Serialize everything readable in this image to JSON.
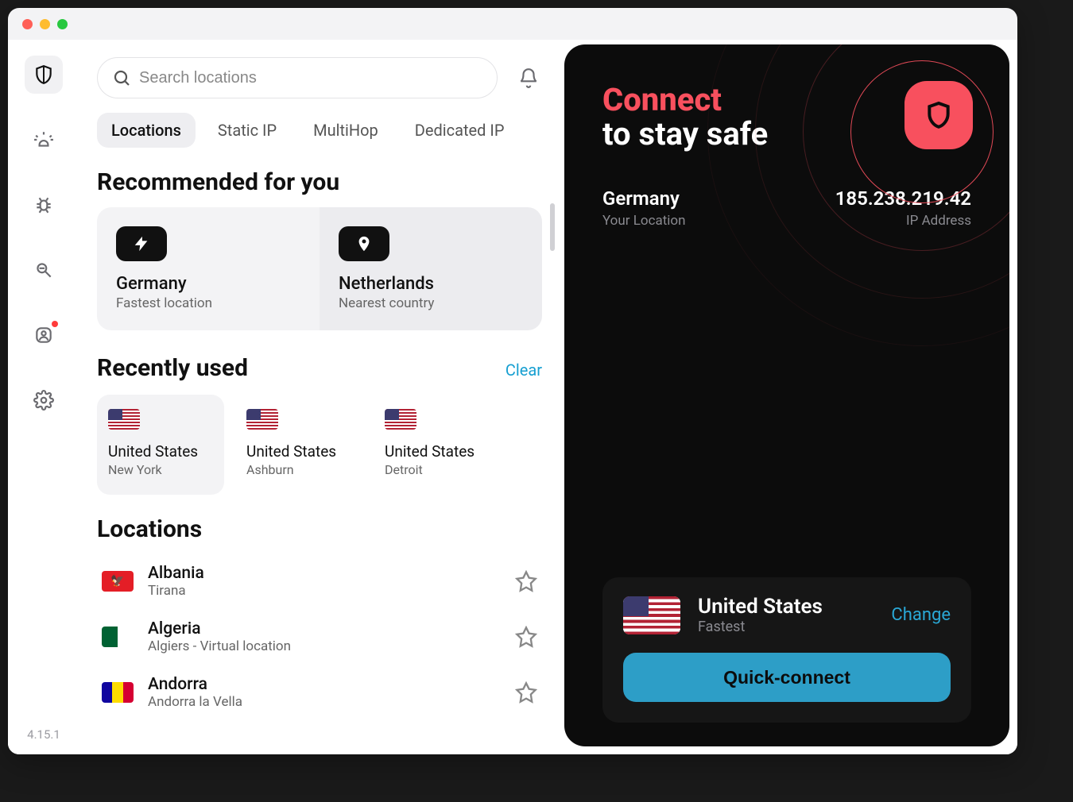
{
  "sidebar": {
    "version": "4.15.1"
  },
  "search": {
    "placeholder": "Search locations"
  },
  "tabs": [
    "Locations",
    "Static IP",
    "MultiHop",
    "Dedicated IP"
  ],
  "recommended": {
    "title": "Recommended for you",
    "items": [
      {
        "name": "Germany",
        "sub": "Fastest location",
        "icon": "bolt"
      },
      {
        "name": "Netherlands",
        "sub": "Nearest country",
        "icon": "pin"
      }
    ]
  },
  "recent": {
    "title": "Recently used",
    "clear": "Clear",
    "items": [
      {
        "country": "United States",
        "city": "New York",
        "flag": "us"
      },
      {
        "country": "United States",
        "city": "Ashburn",
        "flag": "us"
      },
      {
        "country": "United States",
        "city": "Detroit",
        "flag": "us"
      }
    ]
  },
  "locations": {
    "title": "Locations",
    "items": [
      {
        "name": "Albania",
        "sub": "Tirana",
        "flag": "al"
      },
      {
        "name": "Algeria",
        "sub": "Algiers - Virtual location",
        "flag": "dz"
      },
      {
        "name": "Andorra",
        "sub": "Andorra la Vella",
        "flag": "ad"
      }
    ]
  },
  "panel": {
    "title": "Connect",
    "subtitle": "to stay safe",
    "location_value": "Germany",
    "location_label": "Your Location",
    "ip_value": "185.238.219.42",
    "ip_label": "IP Address",
    "selected_country": "United States",
    "selected_sub": "Fastest",
    "change": "Change",
    "quick_connect": "Quick-connect"
  }
}
